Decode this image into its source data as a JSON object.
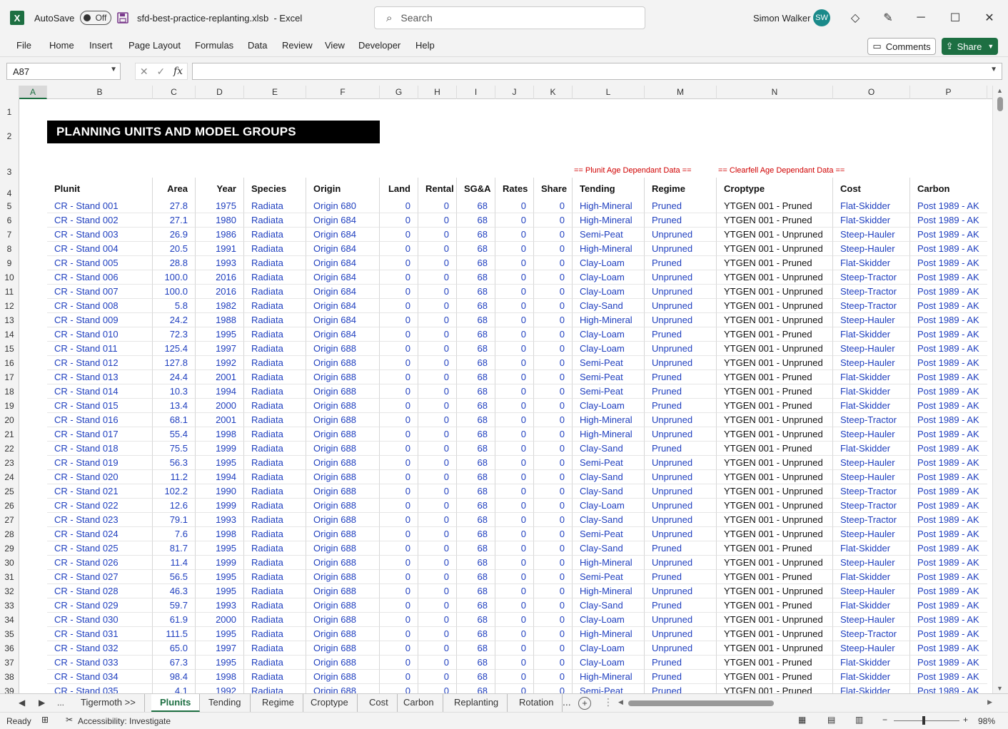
{
  "titlebar": {
    "autosave_label": "AutoSave",
    "autosave_state": "Off",
    "filename": "sfd-best-practice-replanting.xlsb",
    "app": "-  Excel",
    "search_placeholder": "Search",
    "user_name": "Simon Walker",
    "user_initials": "SW",
    "colors": {
      "accent": "#1d6f42",
      "avatar": "#1a8a8a"
    }
  },
  "ribbon": {
    "menus": [
      "File",
      "Home",
      "Insert",
      "Page Layout",
      "Formulas",
      "Data",
      "Review",
      "View",
      "Developer",
      "Help"
    ],
    "comments": "Comments",
    "share": "Share"
  },
  "formula_bar": {
    "name_box": "A87",
    "fx": "fx",
    "formula": ""
  },
  "columns": [
    "A",
    "B",
    "C",
    "D",
    "E",
    "F",
    "G",
    "H",
    "I",
    "J",
    "K",
    "L",
    "M",
    "N",
    "O",
    "P"
  ],
  "row_numbers": [
    "1",
    "2",
    "3",
    "4",
    "5",
    "6",
    "7",
    "8",
    "9",
    "10",
    "11",
    "12",
    "13",
    "14",
    "15",
    "16",
    "17",
    "18",
    "19",
    "20",
    "21",
    "22",
    "23",
    "24",
    "25",
    "26",
    "27",
    "28",
    "29",
    "30",
    "31",
    "32",
    "33",
    "34",
    "35",
    "36",
    "37",
    "38",
    "39"
  ],
  "sheet": {
    "title": "PLANNING UNITS AND MODEL GROUPS",
    "label_plunit_age": "== Plunit Age Dependant Data ==",
    "label_clearfell_age": "== Clearfell Age Dependant Data ==",
    "headers": [
      "Plunit",
      "Area",
      "Year",
      "Species",
      "Origin",
      "Land",
      "Rental",
      "SG&A",
      "Rates",
      "Share",
      "Tending",
      "Regime",
      "Croptype",
      "Cost",
      "Carbon"
    ],
    "rows": [
      [
        "CR - Stand 001",
        "27.8",
        "1975",
        "Radiata",
        "Origin 680",
        "0",
        "0",
        "68",
        "0",
        "0",
        "High-Mineral",
        "Pruned",
        "YTGEN 001 - Pruned",
        "Flat-Skidder",
        "Post 1989 - AK"
      ],
      [
        "CR - Stand 002",
        "27.1",
        "1980",
        "Radiata",
        "Origin 684",
        "0",
        "0",
        "68",
        "0",
        "0",
        "High-Mineral",
        "Pruned",
        "YTGEN 001 - Pruned",
        "Flat-Skidder",
        "Post 1989 - AK"
      ],
      [
        "CR - Stand 003",
        "26.9",
        "1986",
        "Radiata",
        "Origin 684",
        "0",
        "0",
        "68",
        "0",
        "0",
        "Semi-Peat",
        "Unpruned",
        "YTGEN 001 - Unpruned",
        "Steep-Hauler",
        "Post 1989 - AK"
      ],
      [
        "CR - Stand 004",
        "20.5",
        "1991",
        "Radiata",
        "Origin 684",
        "0",
        "0",
        "68",
        "0",
        "0",
        "High-Mineral",
        "Unpruned",
        "YTGEN 001 - Unpruned",
        "Steep-Hauler",
        "Post 1989 - AK"
      ],
      [
        "CR - Stand 005",
        "28.8",
        "1993",
        "Radiata",
        "Origin 684",
        "0",
        "0",
        "68",
        "0",
        "0",
        "Clay-Loam",
        "Pruned",
        "YTGEN 001 - Pruned",
        "Flat-Skidder",
        "Post 1989 - AK"
      ],
      [
        "CR - Stand 006",
        "100.0",
        "2016",
        "Radiata",
        "Origin 684",
        "0",
        "0",
        "68",
        "0",
        "0",
        "Clay-Loam",
        "Unpruned",
        "YTGEN 001 - Unpruned",
        "Steep-Tractor",
        "Post 1989 - AK"
      ],
      [
        "CR - Stand 007",
        "100.0",
        "2016",
        "Radiata",
        "Origin 684",
        "0",
        "0",
        "68",
        "0",
        "0",
        "Clay-Loam",
        "Unpruned",
        "YTGEN 001 - Unpruned",
        "Steep-Tractor",
        "Post 1989 - AK"
      ],
      [
        "CR - Stand 008",
        "5.8",
        "1982",
        "Radiata",
        "Origin 684",
        "0",
        "0",
        "68",
        "0",
        "0",
        "Clay-Sand",
        "Unpruned",
        "YTGEN 001 - Unpruned",
        "Steep-Tractor",
        "Post 1989 - AK"
      ],
      [
        "CR - Stand 009",
        "24.2",
        "1988",
        "Radiata",
        "Origin 684",
        "0",
        "0",
        "68",
        "0",
        "0",
        "High-Mineral",
        "Unpruned",
        "YTGEN 001 - Unpruned",
        "Steep-Hauler",
        "Post 1989 - AK"
      ],
      [
        "CR - Stand 010",
        "72.3",
        "1995",
        "Radiata",
        "Origin 684",
        "0",
        "0",
        "68",
        "0",
        "0",
        "Clay-Loam",
        "Pruned",
        "YTGEN 001 - Pruned",
        "Flat-Skidder",
        "Post 1989 - AK"
      ],
      [
        "CR - Stand 011",
        "125.4",
        "1997",
        "Radiata",
        "Origin 688",
        "0",
        "0",
        "68",
        "0",
        "0",
        "Clay-Loam",
        "Unpruned",
        "YTGEN 001 - Unpruned",
        "Steep-Hauler",
        "Post 1989 - AK"
      ],
      [
        "CR - Stand 012",
        "127.8",
        "1992",
        "Radiata",
        "Origin 688",
        "0",
        "0",
        "68",
        "0",
        "0",
        "Semi-Peat",
        "Unpruned",
        "YTGEN 001 - Unpruned",
        "Steep-Hauler",
        "Post 1989 - AK"
      ],
      [
        "CR - Stand 013",
        "24.4",
        "2001",
        "Radiata",
        "Origin 688",
        "0",
        "0",
        "68",
        "0",
        "0",
        "Semi-Peat",
        "Pruned",
        "YTGEN 001 - Pruned",
        "Flat-Skidder",
        "Post 1989 - AK"
      ],
      [
        "CR - Stand 014",
        "10.3",
        "1994",
        "Radiata",
        "Origin 688",
        "0",
        "0",
        "68",
        "0",
        "0",
        "Semi-Peat",
        "Pruned",
        "YTGEN 001 - Pruned",
        "Flat-Skidder",
        "Post 1989 - AK"
      ],
      [
        "CR - Stand 015",
        "13.4",
        "2000",
        "Radiata",
        "Origin 688",
        "0",
        "0",
        "68",
        "0",
        "0",
        "Clay-Loam",
        "Pruned",
        "YTGEN 001 - Pruned",
        "Flat-Skidder",
        "Post 1989 - AK"
      ],
      [
        "CR - Stand 016",
        "68.1",
        "2001",
        "Radiata",
        "Origin 688",
        "0",
        "0",
        "68",
        "0",
        "0",
        "High-Mineral",
        "Unpruned",
        "YTGEN 001 - Unpruned",
        "Steep-Tractor",
        "Post 1989 - AK"
      ],
      [
        "CR - Stand 017",
        "55.4",
        "1998",
        "Radiata",
        "Origin 688",
        "0",
        "0",
        "68",
        "0",
        "0",
        "High-Mineral",
        "Unpruned",
        "YTGEN 001 - Unpruned",
        "Steep-Hauler",
        "Post 1989 - AK"
      ],
      [
        "CR - Stand 018",
        "75.5",
        "1999",
        "Radiata",
        "Origin 688",
        "0",
        "0",
        "68",
        "0",
        "0",
        "Clay-Sand",
        "Pruned",
        "YTGEN 001 - Pruned",
        "Flat-Skidder",
        "Post 1989 - AK"
      ],
      [
        "CR - Stand 019",
        "56.3",
        "1995",
        "Radiata",
        "Origin 688",
        "0",
        "0",
        "68",
        "0",
        "0",
        "Semi-Peat",
        "Unpruned",
        "YTGEN 001 - Unpruned",
        "Steep-Hauler",
        "Post 1989 - AK"
      ],
      [
        "CR - Stand 020",
        "11.2",
        "1994",
        "Radiata",
        "Origin 688",
        "0",
        "0",
        "68",
        "0",
        "0",
        "Clay-Sand",
        "Unpruned",
        "YTGEN 001 - Unpruned",
        "Steep-Hauler",
        "Post 1989 - AK"
      ],
      [
        "CR - Stand 021",
        "102.2",
        "1990",
        "Radiata",
        "Origin 688",
        "0",
        "0",
        "68",
        "0",
        "0",
        "Clay-Sand",
        "Unpruned",
        "YTGEN 001 - Unpruned",
        "Steep-Tractor",
        "Post 1989 - AK"
      ],
      [
        "CR - Stand 022",
        "12.6",
        "1999",
        "Radiata",
        "Origin 688",
        "0",
        "0",
        "68",
        "0",
        "0",
        "Clay-Loam",
        "Unpruned",
        "YTGEN 001 - Unpruned",
        "Steep-Tractor",
        "Post 1989 - AK"
      ],
      [
        "CR - Stand 023",
        "79.1",
        "1993",
        "Radiata",
        "Origin 688",
        "0",
        "0",
        "68",
        "0",
        "0",
        "Clay-Sand",
        "Unpruned",
        "YTGEN 001 - Unpruned",
        "Steep-Tractor",
        "Post 1989 - AK"
      ],
      [
        "CR - Stand 024",
        "7.6",
        "1998",
        "Radiata",
        "Origin 688",
        "0",
        "0",
        "68",
        "0",
        "0",
        "Semi-Peat",
        "Unpruned",
        "YTGEN 001 - Unpruned",
        "Steep-Hauler",
        "Post 1989 - AK"
      ],
      [
        "CR - Stand 025",
        "81.7",
        "1995",
        "Radiata",
        "Origin 688",
        "0",
        "0",
        "68",
        "0",
        "0",
        "Clay-Sand",
        "Pruned",
        "YTGEN 001 - Pruned",
        "Flat-Skidder",
        "Post 1989 - AK"
      ],
      [
        "CR - Stand 026",
        "11.4",
        "1999",
        "Radiata",
        "Origin 688",
        "0",
        "0",
        "68",
        "0",
        "0",
        "High-Mineral",
        "Unpruned",
        "YTGEN 001 - Unpruned",
        "Steep-Hauler",
        "Post 1989 - AK"
      ],
      [
        "CR - Stand 027",
        "56.5",
        "1995",
        "Radiata",
        "Origin 688",
        "0",
        "0",
        "68",
        "0",
        "0",
        "Semi-Peat",
        "Pruned",
        "YTGEN 001 - Pruned",
        "Flat-Skidder",
        "Post 1989 - AK"
      ],
      [
        "CR - Stand 028",
        "46.3",
        "1995",
        "Radiata",
        "Origin 688",
        "0",
        "0",
        "68",
        "0",
        "0",
        "High-Mineral",
        "Unpruned",
        "YTGEN 001 - Unpruned",
        "Steep-Hauler",
        "Post 1989 - AK"
      ],
      [
        "CR - Stand 029",
        "59.7",
        "1993",
        "Radiata",
        "Origin 688",
        "0",
        "0",
        "68",
        "0",
        "0",
        "Clay-Sand",
        "Pruned",
        "YTGEN 001 - Pruned",
        "Flat-Skidder",
        "Post 1989 - AK"
      ],
      [
        "CR - Stand 030",
        "61.9",
        "2000",
        "Radiata",
        "Origin 688",
        "0",
        "0",
        "68",
        "0",
        "0",
        "Clay-Loam",
        "Unpruned",
        "YTGEN 001 - Unpruned",
        "Steep-Hauler",
        "Post 1989 - AK"
      ],
      [
        "CR - Stand 031",
        "111.5",
        "1995",
        "Radiata",
        "Origin 688",
        "0",
        "0",
        "68",
        "0",
        "0",
        "High-Mineral",
        "Unpruned",
        "YTGEN 001 - Unpruned",
        "Steep-Tractor",
        "Post 1989 - AK"
      ],
      [
        "CR - Stand 032",
        "65.0",
        "1997",
        "Radiata",
        "Origin 688",
        "0",
        "0",
        "68",
        "0",
        "0",
        "Clay-Loam",
        "Unpruned",
        "YTGEN 001 - Unpruned",
        "Steep-Hauler",
        "Post 1989 - AK"
      ],
      [
        "CR - Stand 033",
        "67.3",
        "1995",
        "Radiata",
        "Origin 688",
        "0",
        "0",
        "68",
        "0",
        "0",
        "Clay-Loam",
        "Pruned",
        "YTGEN 001 - Pruned",
        "Flat-Skidder",
        "Post 1989 - AK"
      ],
      [
        "CR - Stand 034",
        "98.4",
        "1998",
        "Radiata",
        "Origin 688",
        "0",
        "0",
        "68",
        "0",
        "0",
        "High-Mineral",
        "Pruned",
        "YTGEN 001 - Pruned",
        "Flat-Skidder",
        "Post 1989 - AK"
      ],
      [
        "CR - Stand 035",
        "4.1",
        "1992",
        "Radiata",
        "Origin 688",
        "0",
        "0",
        "68",
        "0",
        "0",
        "Semi-Peat",
        "Pruned",
        "YTGEN 001 - Pruned",
        "Flat-Skidder",
        "Post 1989 - AK"
      ]
    ]
  },
  "tabs": {
    "overflow_left": "...",
    "items": [
      "Tigermoth >>",
      "Plunits",
      "Tending",
      "Regime",
      "Croptype",
      "Cost",
      "Carbon",
      "Replanting",
      "Rotation"
    ],
    "active": "Plunits",
    "overflow_right": "..."
  },
  "statusbar": {
    "ready": "Ready",
    "accessibility": "Accessibility: Investigate",
    "zoom": "98%"
  }
}
